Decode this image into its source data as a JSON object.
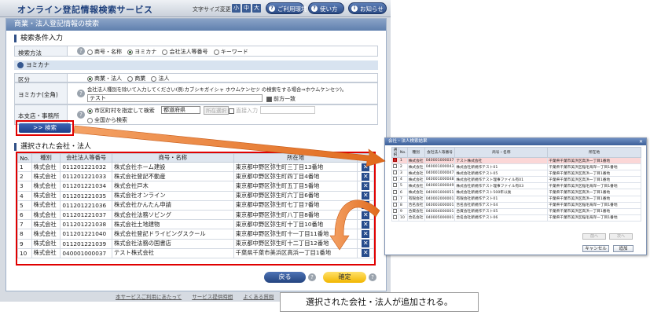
{
  "header": {
    "app_title": "オンライン登記情報検索サービス",
    "font_size_label": "文字サイズ変更",
    "font_small": "小",
    "font_medium": "中",
    "font_large": "大",
    "env_button": "ご利用環境",
    "howto_button": "使い方",
    "notice_button": "お知らせ"
  },
  "page_title": "商業・法人登記情報の検索",
  "search_conditions": {
    "title": "検索条件入力",
    "method_label": "検索方法",
    "method_options": [
      "商号・名称",
      "ヨミカナ",
      "会社法人等番号",
      "キーワード"
    ],
    "method_selected": "ヨミカナ",
    "yomikana_heading": "ヨミカナ",
    "category_label": "区分",
    "category_options": [
      "商業・法人",
      "商業",
      "法人"
    ],
    "yomikana_label": "ヨミカナ(全角)",
    "yomikana_hint": "会社法人種別を除いて入力してください(例:カブシキガイシャ ホウムケンセツ の検索をする場合⇒ホウムケンセツ)。",
    "yomikana_value": "テスト",
    "prefix_match": "前方一致",
    "office_label": "本支店・事務所",
    "office_option1": "市区町村を指定して検索",
    "prefecture_placeholder": "都道府県",
    "location_button": "所在選択",
    "direct_input": "直接入力",
    "office_option2": "全国から検索",
    "search_button": ">> 検索"
  },
  "selected": {
    "title": "選択された会社・法人",
    "columns": [
      "No.",
      "種別",
      "会社法人等番号",
      "商号・名称",
      "所在地",
      ""
    ],
    "rows": [
      {
        "no": "1",
        "type": "株式会社",
        "number": "011201221032",
        "name": "株式会社ホーム建設",
        "address": "東京都中野区弥生町三丁目13番地"
      },
      {
        "no": "2",
        "type": "株式会社",
        "number": "011201221033",
        "name": "株式会社登記不動産",
        "address": "東京都中野区弥生町四丁目4番地"
      },
      {
        "no": "3",
        "type": "株式会社",
        "number": "011201221034",
        "name": "株式会社戸木",
        "address": "東京都中野区弥生町五丁目5番地"
      },
      {
        "no": "4",
        "type": "株式会社",
        "number": "011201221035",
        "name": "株式会社オンライン",
        "address": "東京都中野区弥生町六丁目6番地"
      },
      {
        "no": "5",
        "type": "株式会社",
        "number": "011201221036",
        "name": "株式会社かんたん申請",
        "address": "東京都中野区弥生町七丁目7番地"
      },
      {
        "no": "6",
        "type": "株式会社",
        "number": "011201221037",
        "name": "株式会社法務ソビング",
        "address": "東京都中野区弥生町八丁目8番地"
      },
      {
        "no": "7",
        "type": "株式会社",
        "number": "011201221038",
        "name": "株式会社土地建物",
        "address": "東京都中野区弥生町十丁目10番地"
      },
      {
        "no": "8",
        "type": "株式会社",
        "number": "011201221040",
        "name": "株式会社登記ドライビングスクール",
        "address": "東京都中野区弥生町十一丁目11番地"
      },
      {
        "no": "9",
        "type": "株式会社",
        "number": "011201221039",
        "name": "株式会社法務の国書店",
        "address": "東京都中野区弥生町十二丁目12番地"
      },
      {
        "no": "10",
        "type": "株式会社",
        "number": "040001000037",
        "name": "テスト株式会社",
        "address": "千葉県千葉市美浜区高浜一丁目1番地"
      }
    ],
    "delete_glyph": "✕"
  },
  "actions": {
    "back_button": "戻る",
    "confirm_button": "確定"
  },
  "footer_links": [
    "本サービスご利用にあたって",
    "サービス提供時間",
    "よくある質問"
  ],
  "dialog": {
    "title": "会社・法人検索結果",
    "columns": [
      "選択",
      "No.",
      "種別",
      "会社法人等番号",
      "商号・名称",
      "所在地"
    ],
    "rows": [
      {
        "no": "1",
        "type": "株式会社",
        "number": "040001000037",
        "name": "テスト株式会社",
        "address": "千葉県千葉市美浜区高浜一丁目1番地",
        "checked": true
      },
      {
        "no": "2",
        "type": "株式会社",
        "number": "040001000043",
        "name": "株式会社新規作テスト01",
        "address": "千葉県千葉市美浜区稲毛海岸一丁目1番地",
        "checked": false
      },
      {
        "no": "3",
        "type": "株式会社",
        "number": "040001000047",
        "name": "株式会社新規作テスト05",
        "address": "千葉県千葉市美浜区高浜一丁目1番地",
        "checked": false
      },
      {
        "no": "4",
        "type": "株式会社",
        "number": "040001000048",
        "name": "株式会社新規作テスト理事ファイル有01",
        "address": "千葉県千葉市美浜区高浜一丁目1番地",
        "checked": false
      },
      {
        "no": "5",
        "type": "株式会社",
        "number": "040001000049",
        "name": "株式会社新規作テスト理事ファイル有03",
        "address": "千葉県千葉市美浜区稲毛海岸一丁目1番地",
        "checked": false
      },
      {
        "no": "6",
        "type": "株式会社",
        "number": "040001000051",
        "name": "株式会社新規作テスト500年以後",
        "address": "千葉県千葉市美浜区高浜一丁目1番地",
        "checked": false
      },
      {
        "no": "7",
        "type": "有限会社",
        "number": "040002000001",
        "name": "有限会社新規作テスト01",
        "address": "千葉県千葉市美浜区高浜一丁目1番地",
        "checked": false
      },
      {
        "no": "8",
        "type": "合名会社",
        "number": "040003000001",
        "name": "合名会社新規作テスト04",
        "address": "千葉県千葉市美浜区稲毛海岸一丁目1番地",
        "checked": false
      },
      {
        "no": "9",
        "type": "合資会社",
        "number": "040004000001",
        "name": "合資会社新規作テスト05",
        "address": "千葉県千葉市美浜区高浜一丁目1番地",
        "checked": false
      },
      {
        "no": "10",
        "type": "合名会社",
        "number": "040005000001",
        "name": "合名会社新規作テスト06",
        "address": "千葉県千葉市美浜区稲毛海岸一丁目1番地",
        "checked": false
      }
    ],
    "prev_button": "前へ",
    "next_button": "次へ",
    "cancel_button": "キャンセル",
    "add_button": "追加"
  },
  "caption": "選択された会社・法人が追加される。",
  "colors": {
    "highlight_red": "#e00000",
    "arrow_orange": "#e8762a",
    "header_navy": "#1d3f7c",
    "confirm_yellow": "#f2b600"
  },
  "icons": {
    "font_size": "text-size-icon",
    "help": "question-icon",
    "delete": "close-icon",
    "section": "gear-icon"
  }
}
